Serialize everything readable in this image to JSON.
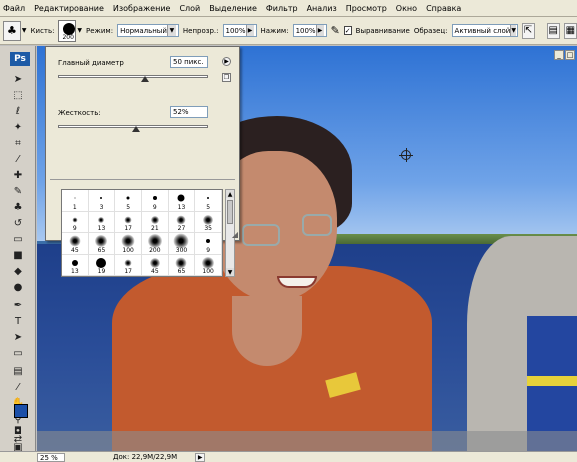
{
  "menu": [
    "Файл",
    "Редактирование",
    "Изображение",
    "Слой",
    "Выделение",
    "Фильтр",
    "Анализ",
    "Просмотр",
    "Окно",
    "Справка"
  ],
  "options": {
    "brush_label": "Кисть:",
    "brush_size": "200",
    "mode_label": "Режим:",
    "mode_value": "Нормальный",
    "opacity_label": "Непрозр.:",
    "opacity_value": "100%",
    "pressure_label": "Нажим:",
    "pressure_value": "100%",
    "aligned_label": "Выравнивание",
    "sample_label": "Образец:",
    "sample_value": "Активный слой"
  },
  "toolbox": {
    "logo": "Ps"
  },
  "brush_popup": {
    "diameter_label": "Главный диаметр",
    "diameter_value": "50 пикс.",
    "hardness_label": "Жесткость:",
    "hardness_value": "52%",
    "diameter_fraction": 0.58,
    "hardness_fraction": 0.52,
    "presets": [
      {
        "size": "1",
        "d": 1,
        "soft": false
      },
      {
        "size": "3",
        "d": 2,
        "soft": false
      },
      {
        "size": "5",
        "d": 3,
        "soft": false
      },
      {
        "size": "9",
        "d": 4,
        "soft": false
      },
      {
        "size": "13",
        "d": 7,
        "soft": false
      },
      {
        "size": "5",
        "d": 2,
        "soft": false
      },
      {
        "size": "9",
        "d": 3,
        "soft": true
      },
      {
        "size": "13",
        "d": 4,
        "soft": true
      },
      {
        "size": "17",
        "d": 5,
        "soft": true
      },
      {
        "size": "21",
        "d": 6,
        "soft": true
      },
      {
        "size": "27",
        "d": 7,
        "soft": true
      },
      {
        "size": "35",
        "d": 8,
        "soft": true
      },
      {
        "size": "45",
        "d": 9,
        "soft": true
      },
      {
        "size": "65",
        "d": 10,
        "soft": true
      },
      {
        "size": "100",
        "d": 11,
        "soft": true
      },
      {
        "size": "200",
        "d": 12,
        "soft": true
      },
      {
        "size": "300",
        "d": 13,
        "soft": true
      },
      {
        "size": "9",
        "d": 4,
        "soft": false
      },
      {
        "size": "13",
        "d": 6,
        "soft": false
      },
      {
        "size": "19",
        "d": 10,
        "soft": false
      },
      {
        "size": "17",
        "d": 5,
        "soft": true
      },
      {
        "size": "45",
        "d": 8,
        "soft": true
      },
      {
        "size": "65",
        "d": 9,
        "soft": true
      },
      {
        "size": "100",
        "d": 10,
        "soft": true
      }
    ]
  },
  "status": {
    "zoom": "25 %",
    "doc": "Док: 22,9M/22,9M"
  }
}
